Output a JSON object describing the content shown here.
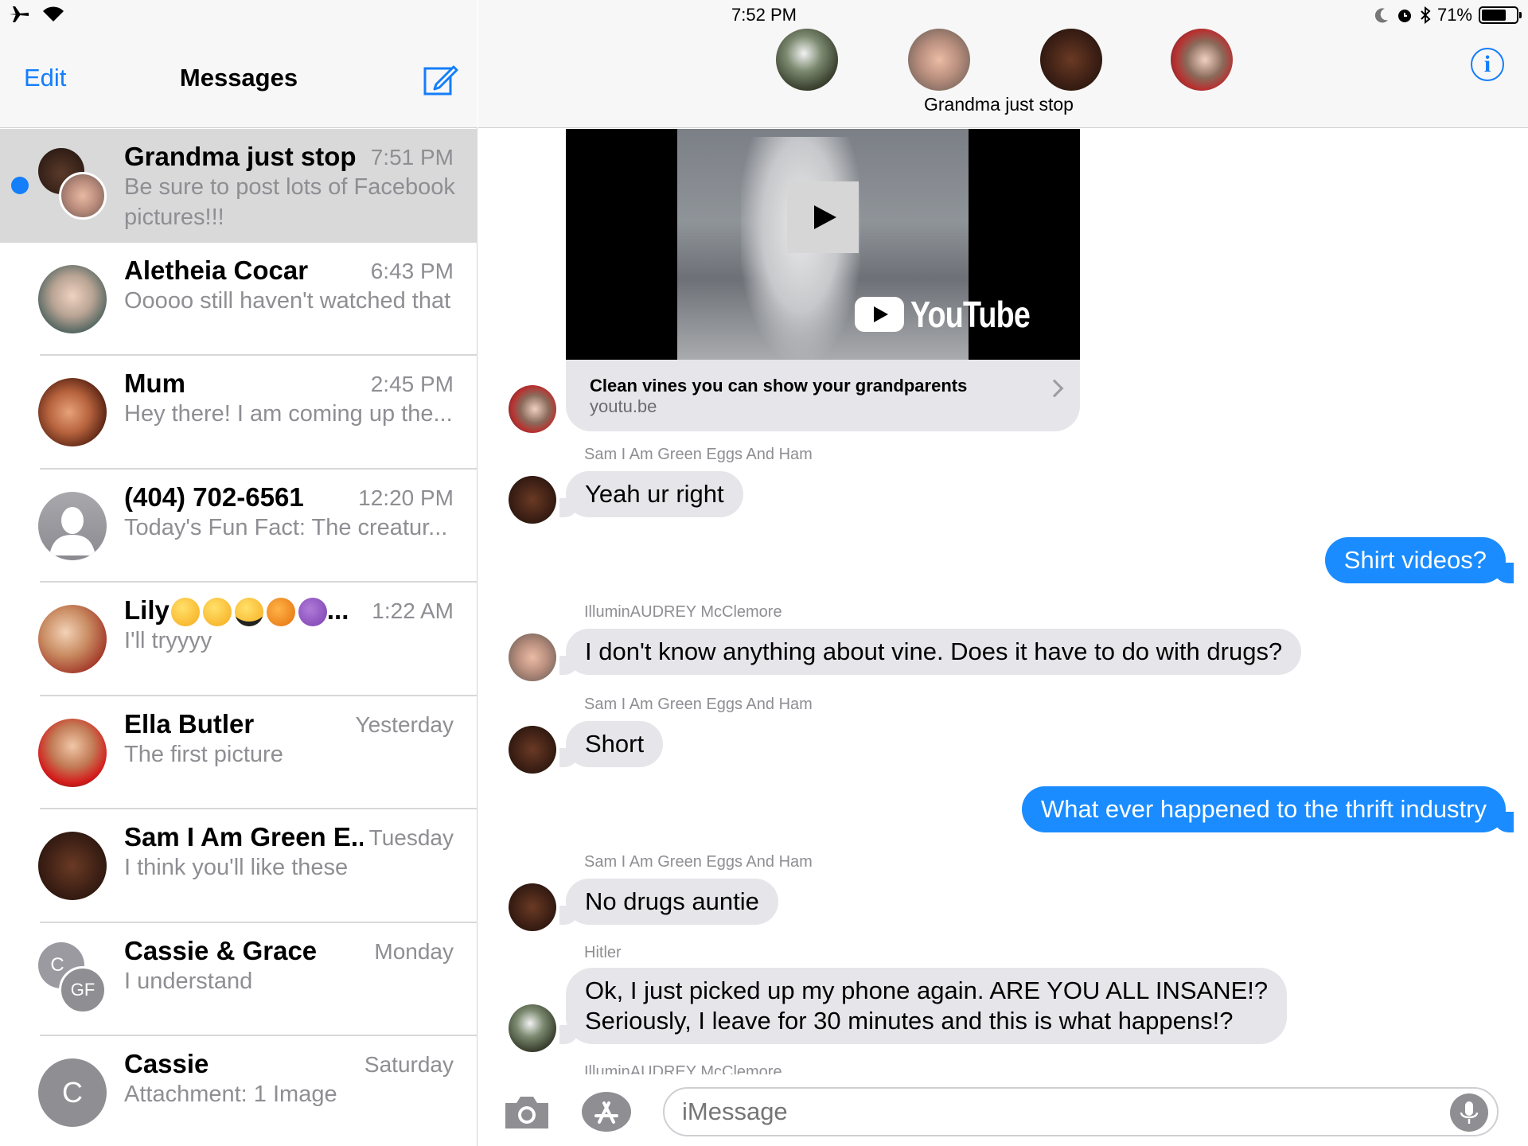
{
  "status_bar": {
    "time": "7:52 PM",
    "battery": "71%",
    "battery_level": 0.71
  },
  "sidebar": {
    "edit_label": "Edit",
    "title": "Messages",
    "conversations": [
      {
        "name": "Grandma just stop",
        "time": "7:51 PM",
        "preview": "Be sure to post lots of Facebook pictures!!!",
        "unread": true,
        "selected": true
      },
      {
        "name": "Aletheia Cocar",
        "time": "6:43 PM",
        "preview": "Ooooo still haven't watched that"
      },
      {
        "name": "Mum",
        "time": "2:45 PM",
        "preview": "Hey there! I am coming up the..."
      },
      {
        "name": "(404) 702-6561",
        "time": "12:20 PM",
        "preview": "Today's Fun Fact: The creatur..."
      },
      {
        "name": "Lily",
        "name_suffix": "...",
        "time": "1:22 AM",
        "preview": "I'll tryyyy"
      },
      {
        "name": "Ella Butler",
        "time": "Yesterday",
        "preview": "The first picture"
      },
      {
        "name": "Sam I Am Green E...",
        "time": "Tuesday",
        "preview": "I think you'll like these"
      },
      {
        "name": "Cassie & Grace",
        "time": "Monday",
        "preview": "I understand",
        "avatar_initials": [
          "C",
          "GF"
        ]
      },
      {
        "name": "Cassie",
        "time": "Saturday",
        "preview": "Attachment: 1 Image",
        "avatar_initials": [
          "C"
        ]
      }
    ]
  },
  "chat": {
    "group_name": "Grandma just stop",
    "info_label": "i",
    "link_preview": {
      "title": "Clean vines you can show your grandparents",
      "domain": "youtu.be",
      "logo_text": "YouTube"
    },
    "messages": [
      {
        "sender": "Sam I Am Green Eggs And Ham",
        "text": "Yeah ur right",
        "direction": "in"
      },
      {
        "text": "Shirt videos?",
        "direction": "out"
      },
      {
        "sender": "IlluminAUDREY McClemore",
        "text": "I don't know anything about vine. Does it have to do with drugs?",
        "direction": "in"
      },
      {
        "sender": "Sam I Am Green Eggs And Ham",
        "text": "Short",
        "direction": "in"
      },
      {
        "text": "What ever happened to the thrift industry",
        "direction": "out"
      },
      {
        "sender": "Sam I Am Green Eggs And Ham",
        "text": "No drugs auntie",
        "direction": "in"
      },
      {
        "sender": "Hitler",
        "text_line1": "Ok, I just picked up my phone again. ARE YOU ALL INSANE!?",
        "text_line2": "Seriously, I leave for 30 minutes and this is what happens!?",
        "direction": "in"
      },
      {
        "sender": "IlluminAUDREY McClemore"
      }
    ]
  },
  "input": {
    "placeholder": "iMessage"
  },
  "colors": {
    "accent": "#147efb",
    "outgoing_bubble": "#1a8cff",
    "incoming_bubble": "#e5e5ea",
    "selected_row": "#d9d9d9"
  },
  "icons": [
    "airplane-icon",
    "wifi-icon",
    "moon-icon",
    "alarm-icon",
    "bluetooth-icon",
    "battery-icon",
    "compose-icon",
    "info-icon",
    "play-icon",
    "chevron-right-icon",
    "camera-icon",
    "app-store-icon",
    "microphone-icon"
  ]
}
